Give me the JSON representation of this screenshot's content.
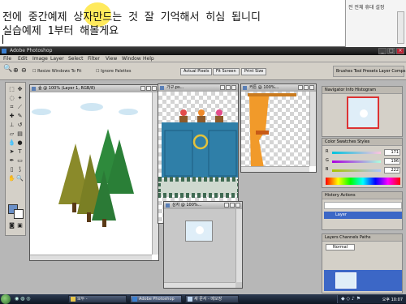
{
  "note": {
    "line1": "전에 중간예제 상자만드는 것 잘 기억해서 히심 됩니디",
    "line2": "실습예제 1부터 해볼게요",
    "side_title": "전 전체 휴대 설정",
    "side_title_short": "전 전체 휴대 설정"
  },
  "photoshop": {
    "title": "Adobe Photoshop",
    "menus": [
      "File",
      "Edit",
      "Image",
      "Layer",
      "Select",
      "Filter",
      "View",
      "Window",
      "Help"
    ],
    "options": {
      "resize_windows": "Resize Windows To Fit",
      "ignore_palettes": "Ignore Palettes",
      "actual_pixels": "Actual Pixels",
      "fit_screen": "Fit Screen",
      "print_size": "Print Size"
    },
    "well_tabs": "Brushes  Tool Presets  Layer Comps",
    "docs": {
      "forest": "숲 @ 100% (Layer 1, RGB/8)",
      "cabinet": "가구.ps...",
      "curtain": "커튼 @ 100%...",
      "small": "상자 @ 100%..."
    },
    "navigator_tabs": "Navigator  Info  Histogram",
    "color_tabs": "Color  Swatches  Styles",
    "color": {
      "r": "R",
      "g": "G",
      "b": "B",
      "r_val": "171",
      "g_val": "196",
      "b_val": "222"
    },
    "layers_tabs": "History  Actions",
    "layer_name": "Layer",
    "bottom_tabs": "Layers  Channels  Paths",
    "bottom_blend": "Normal"
  },
  "taskbar": {
    "items": [
      "모두 -",
      "Adobe Photoshop",
      "새 문서 - 메모장"
    ],
    "clock": "오후 10:07"
  },
  "colors": {
    "accent": "#ffe84a",
    "ps_bg": "#b7b7b7",
    "cabinet_blue": "#2f7fa8",
    "curtain_orange": "#f19a2a"
  }
}
